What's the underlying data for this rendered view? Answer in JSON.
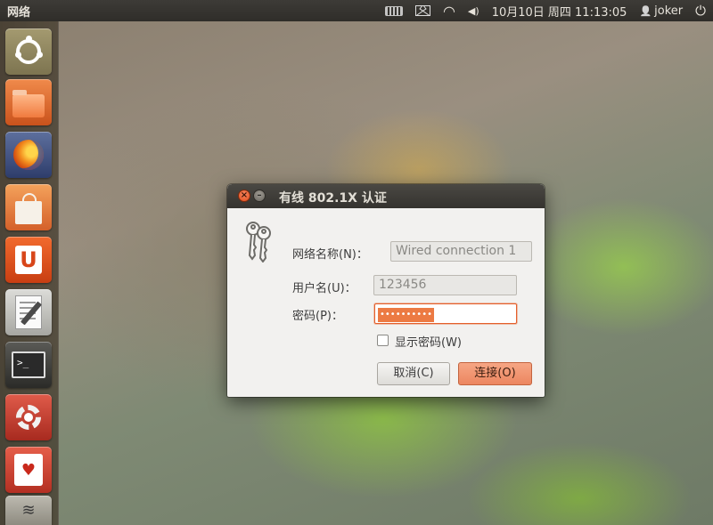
{
  "top_panel": {
    "app_title": "网络",
    "indicators": {
      "keyboard": "keyboard-icon",
      "mail": "mail-icon",
      "wifi_symbol": "◠",
      "volume_symbol": "◀)",
      "clock": "10月10日 周四 11:13:05",
      "user_symbol": "👤",
      "user": "joker",
      "power_symbol": "⏻"
    }
  },
  "launcher": {
    "items": [
      {
        "name": "dash"
      },
      {
        "name": "files"
      },
      {
        "name": "firefox"
      },
      {
        "name": "software-center"
      },
      {
        "name": "ubuntu-one"
      },
      {
        "name": "text-editor"
      },
      {
        "name": "terminal"
      },
      {
        "name": "system-settings"
      },
      {
        "name": "solitaire"
      },
      {
        "name": "network"
      }
    ],
    "terminal_prompt": ">_",
    "cards_symbol": "♥",
    "u_letter": "U",
    "wifi_symbol": "≋"
  },
  "dialog": {
    "title": "有线 802.1X 认证",
    "close_symbol": "×",
    "min_symbol": "–",
    "network_label": "网络名称(N)：",
    "network_value": "Wired connection 1",
    "username_label": "用户名(U)：",
    "username_value": "123456",
    "password_label": "密码(P)：",
    "password_mask": "••••••••••",
    "show_password_label": "显示密码(W)",
    "show_password_checked": false,
    "cancel_label": "取消(C)",
    "connect_label": "连接(O)"
  },
  "colors": {
    "accent": "#e45f2b",
    "panel_bg": "#35332f",
    "dialog_bg": "#f2f1ef"
  }
}
